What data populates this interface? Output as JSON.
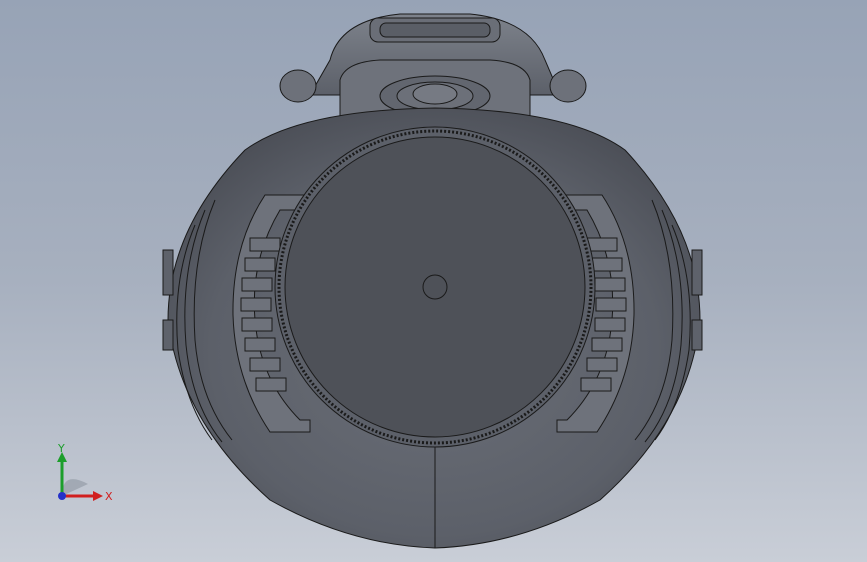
{
  "viewport": {
    "background_top": "#97a3b6",
    "background_bottom": "#c9ced7"
  },
  "model": {
    "body_color": "#5a5e66",
    "gear_face_color": "#4e5158",
    "edge_color": "#1a1a1a",
    "highlight_color": "#8a8f98"
  },
  "triad": {
    "x_label": "X",
    "y_label": "Y",
    "x_color": "#d11f1f",
    "y_color": "#1c9e2b",
    "z_color": "#2431c9"
  }
}
